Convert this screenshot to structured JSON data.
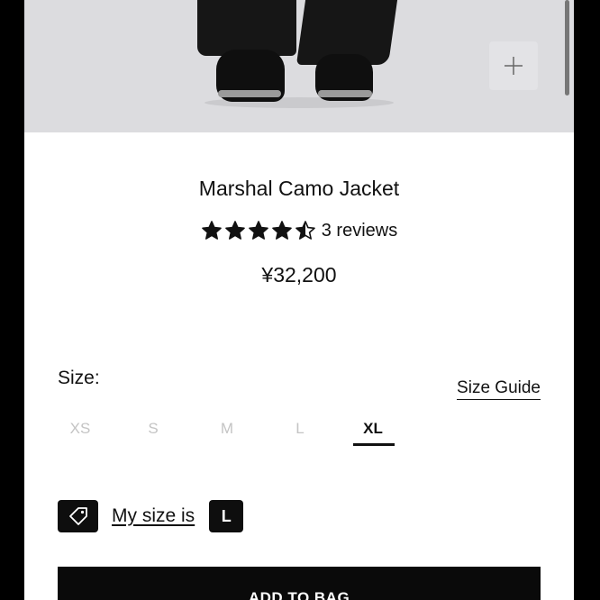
{
  "product": {
    "title": "Marshal Camo Jacket",
    "rating": 4.5,
    "reviews": "3 reviews",
    "price": "¥32,200"
  },
  "hero": {
    "zoom_icon": "plus-icon"
  },
  "size": {
    "label": "Size:",
    "guide": "Size Guide",
    "options": [
      "XS",
      "S",
      "M",
      "L",
      "XL"
    ],
    "selected": "XL"
  },
  "my_size": {
    "icon": "tag-icon",
    "label": "My size is",
    "value": "L"
  },
  "actions": {
    "add_to_bag": "ADD TO BAG"
  },
  "colors": {
    "accent": "#0e0e0e",
    "muted_size": "#c4c4c4",
    "hero_bg": "#dcdcdf"
  }
}
